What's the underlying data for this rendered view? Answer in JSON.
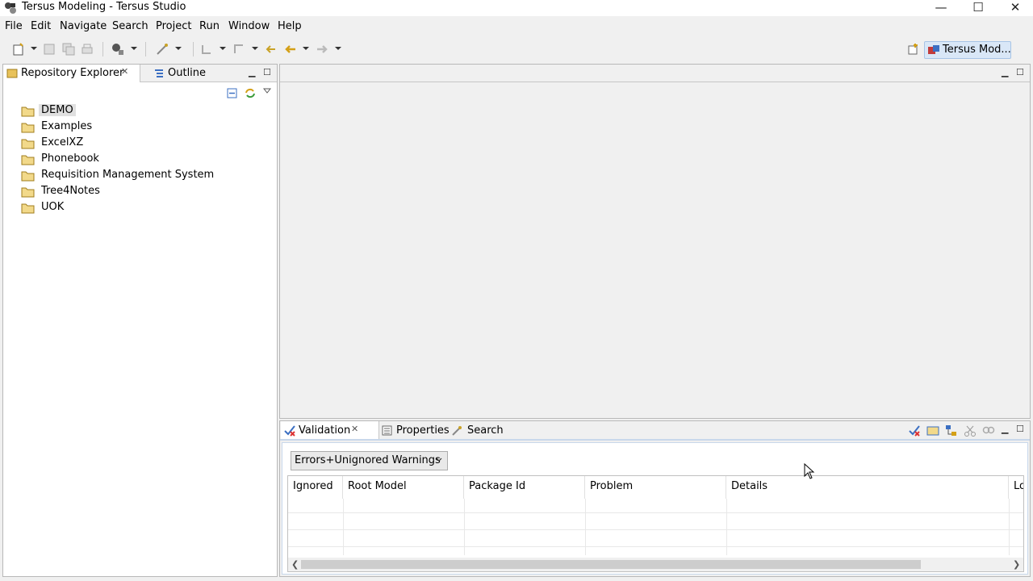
{
  "window": {
    "title": "Tersus Modeling - Tersus Studio",
    "controls": {
      "minimize": "—",
      "maximize": "☐",
      "close": "✕"
    }
  },
  "menu": [
    "File",
    "Edit",
    "Navigate",
    "Search",
    "Project",
    "Run",
    "Window",
    "Help"
  ],
  "toolbar": {
    "perspective_label": "Tersus Mod..."
  },
  "left_panel": {
    "tabs": [
      "Repository Explorer",
      "Outline"
    ],
    "tree": [
      "DEMO",
      "Examples",
      "ExcelXZ",
      "Phonebook",
      "Requisition Management System",
      "Tree4Notes",
      "UOK"
    ],
    "selected": "DEMO"
  },
  "bottom_panel": {
    "tabs": [
      "Validation",
      "Properties",
      "Search"
    ],
    "filter": {
      "selected": "Errors+Unignored Warnings"
    },
    "table": {
      "columns": [
        "Ignored",
        "Root Model",
        "Package Id",
        "Problem",
        "Details",
        "Lo"
      ]
    }
  },
  "colors": {
    "accent": "#d9e7f7",
    "folder": "#e8c25a",
    "panel_border": "#c8d8eb"
  }
}
